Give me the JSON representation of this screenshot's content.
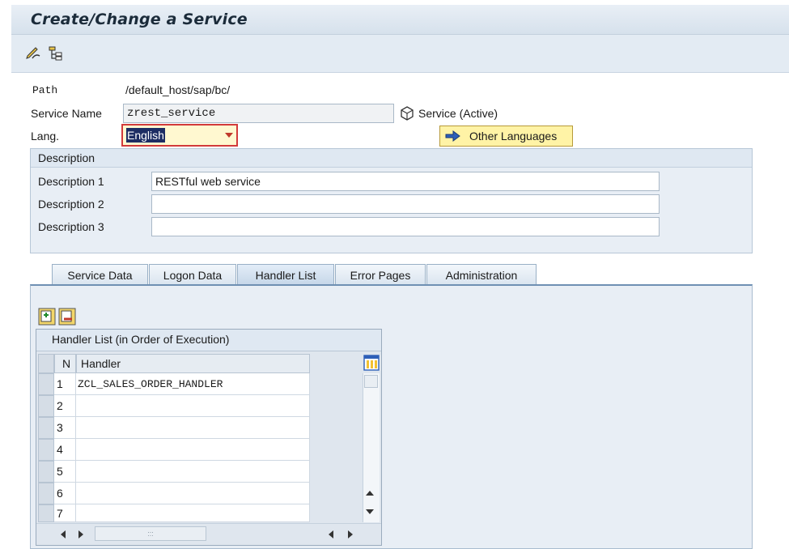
{
  "window": {
    "title": "Create/Change a Service"
  },
  "toolbar": {
    "icons": [
      "pencil-icon",
      "hierarchy-icon"
    ]
  },
  "form": {
    "path_label": "Path",
    "path_value": "/default_host/sap/bc/",
    "service_name_label": "Service Name",
    "service_name_value": "zrest_service",
    "service_status": "Service (Active)",
    "lang_label": "Lang.",
    "lang_value": "English",
    "other_languages_label": "Other Languages"
  },
  "description": {
    "header": "Description",
    "rows": [
      {
        "label": "Description 1",
        "value": "RESTful web service"
      },
      {
        "label": "Description 2",
        "value": ""
      },
      {
        "label": "Description 3",
        "value": ""
      }
    ]
  },
  "tabs": [
    {
      "label": "Service Data",
      "active": false
    },
    {
      "label": "Logon Data",
      "active": false
    },
    {
      "label": "Handler List",
      "active": true
    },
    {
      "label": "Error Pages",
      "active": false
    },
    {
      "label": "Administration",
      "active": false
    }
  ],
  "handler_table": {
    "title": "Handler List (in Order of Execution)",
    "col_n": "N",
    "col_handler": "Handler",
    "rows": [
      {
        "n": "1",
        "handler": "ZCL_SALES_ORDER_HANDLER"
      },
      {
        "n": "2",
        "handler": ""
      },
      {
        "n": "3",
        "handler": ""
      },
      {
        "n": "4",
        "handler": ""
      },
      {
        "n": "5",
        "handler": ""
      },
      {
        "n": "6",
        "handler": ""
      },
      {
        "n": "7",
        "handler": ""
      }
    ],
    "hscroll_grip": ":::"
  },
  "colors": {
    "title_bg": "#dde6ef",
    "accent": "#1d2d63",
    "required_border": "#d23a3a",
    "button_bg": "#fff3a6"
  }
}
